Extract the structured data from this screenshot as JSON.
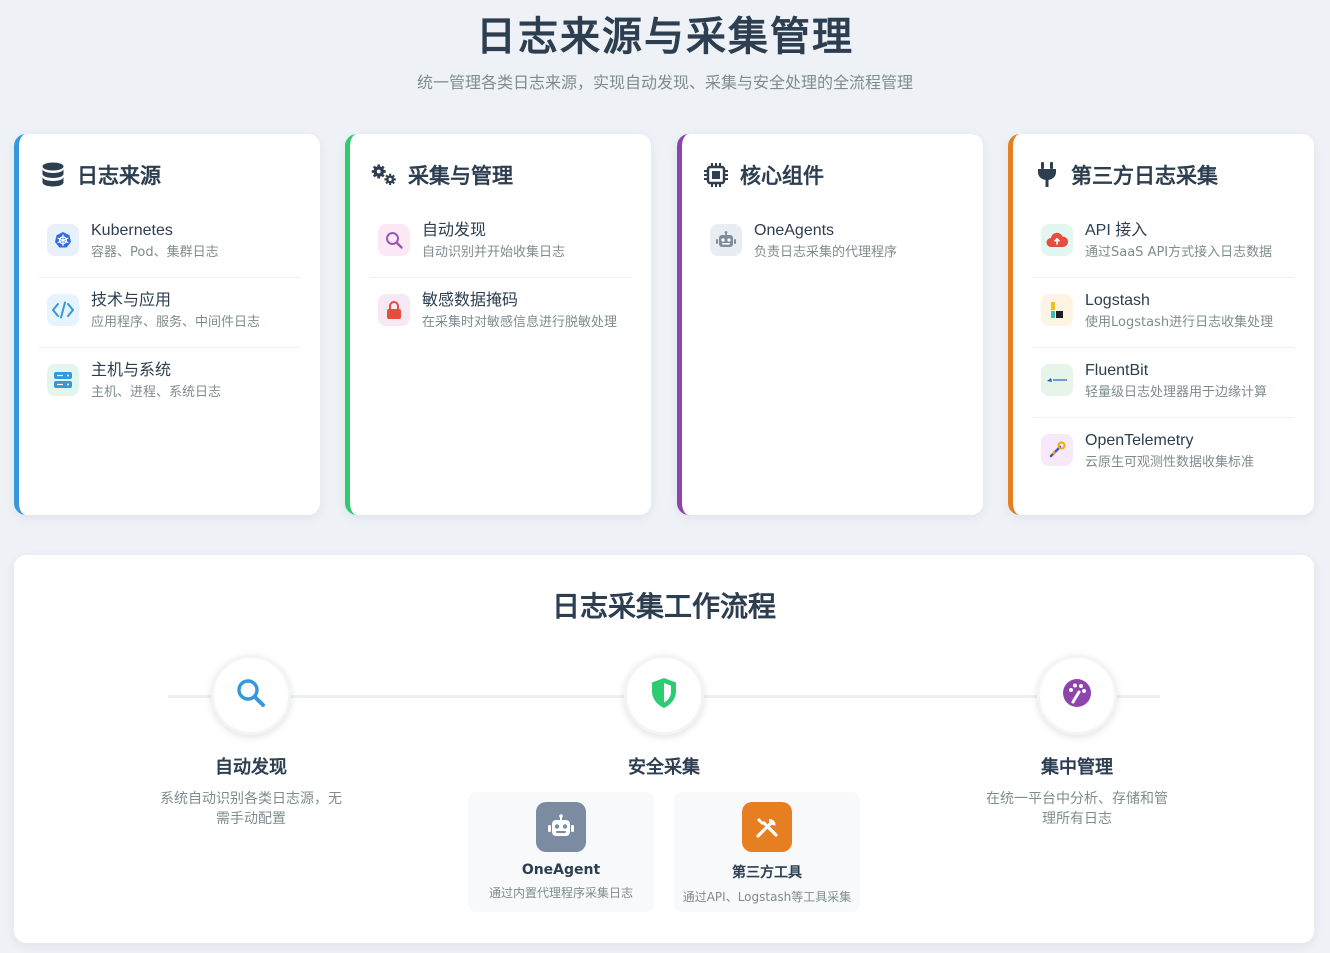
{
  "header": {
    "title": "日志来源与采集管理",
    "subtitle": "统一管理各类日志来源，实现自动发现、采集与安全处理的全流程管理"
  },
  "colors": {
    "blue": "#3498db",
    "green": "#2ecc71",
    "purple": "#8e44ad",
    "orange": "#e67e22",
    "text": "#2c3e50",
    "muted": "#7f8c8d"
  },
  "cards": [
    {
      "title": "日志来源",
      "icon": "database-icon",
      "items": [
        {
          "title": "Kubernetes",
          "desc": "容器、Pod、集群日志",
          "icon": "kubernetes-icon"
        },
        {
          "title": "技术与应用",
          "desc": "应用程序、服务、中间件日志",
          "icon": "code-icon"
        },
        {
          "title": "主机与系统",
          "desc": "主机、进程、系统日志",
          "icon": "server-icon"
        }
      ]
    },
    {
      "title": "采集与管理",
      "icon": "cogs-icon",
      "items": [
        {
          "title": "自动发现",
          "desc": "自动识别并开始收集日志",
          "icon": "search-icon"
        },
        {
          "title": "敏感数据掩码",
          "desc": "在采集时对敏感信息进行脱敏处理",
          "icon": "lock-icon"
        }
      ]
    },
    {
      "title": "核心组件",
      "icon": "chip-icon",
      "items": [
        {
          "title": "OneAgents",
          "desc": "负责日志采集的代理程序",
          "icon": "robot-icon"
        }
      ]
    },
    {
      "title": "第三方日志采集",
      "icon": "plug-icon",
      "items": [
        {
          "title": "API 接入",
          "desc": "通过SaaS API方式接入日志数据",
          "icon": "cloud-upload-icon"
        },
        {
          "title": "Logstash",
          "desc": "使用Logstash进行日志收集处理",
          "icon": "logstash-icon"
        },
        {
          "title": "FluentBit",
          "desc": "轻量级日志处理器用于边缘计算",
          "icon": "fluentbit-icon"
        },
        {
          "title": "OpenTelemetry",
          "desc": "云原生可观测性数据收集标准",
          "icon": "opentelemetry-icon"
        }
      ]
    }
  ],
  "workflow": {
    "title": "日志采集工作流程",
    "steps": [
      {
        "title": "自动发现",
        "desc": "系统自动识别各类日志源，无需手动配置",
        "icon": "search-icon"
      },
      {
        "title": "安全采集",
        "desc": "",
        "icon": "shield-icon"
      },
      {
        "title": "集中管理",
        "desc": "在统一平台中分析、存储和管理所有日志",
        "icon": "palette-icon"
      }
    ],
    "methods": [
      {
        "title": "OneAgent",
        "desc": "通过内置代理程序采集日志",
        "icon": "robot-icon"
      },
      {
        "title": "第三方工具",
        "desc": "通过API、Logstash等工具采集",
        "icon": "tools-icon"
      }
    ]
  }
}
